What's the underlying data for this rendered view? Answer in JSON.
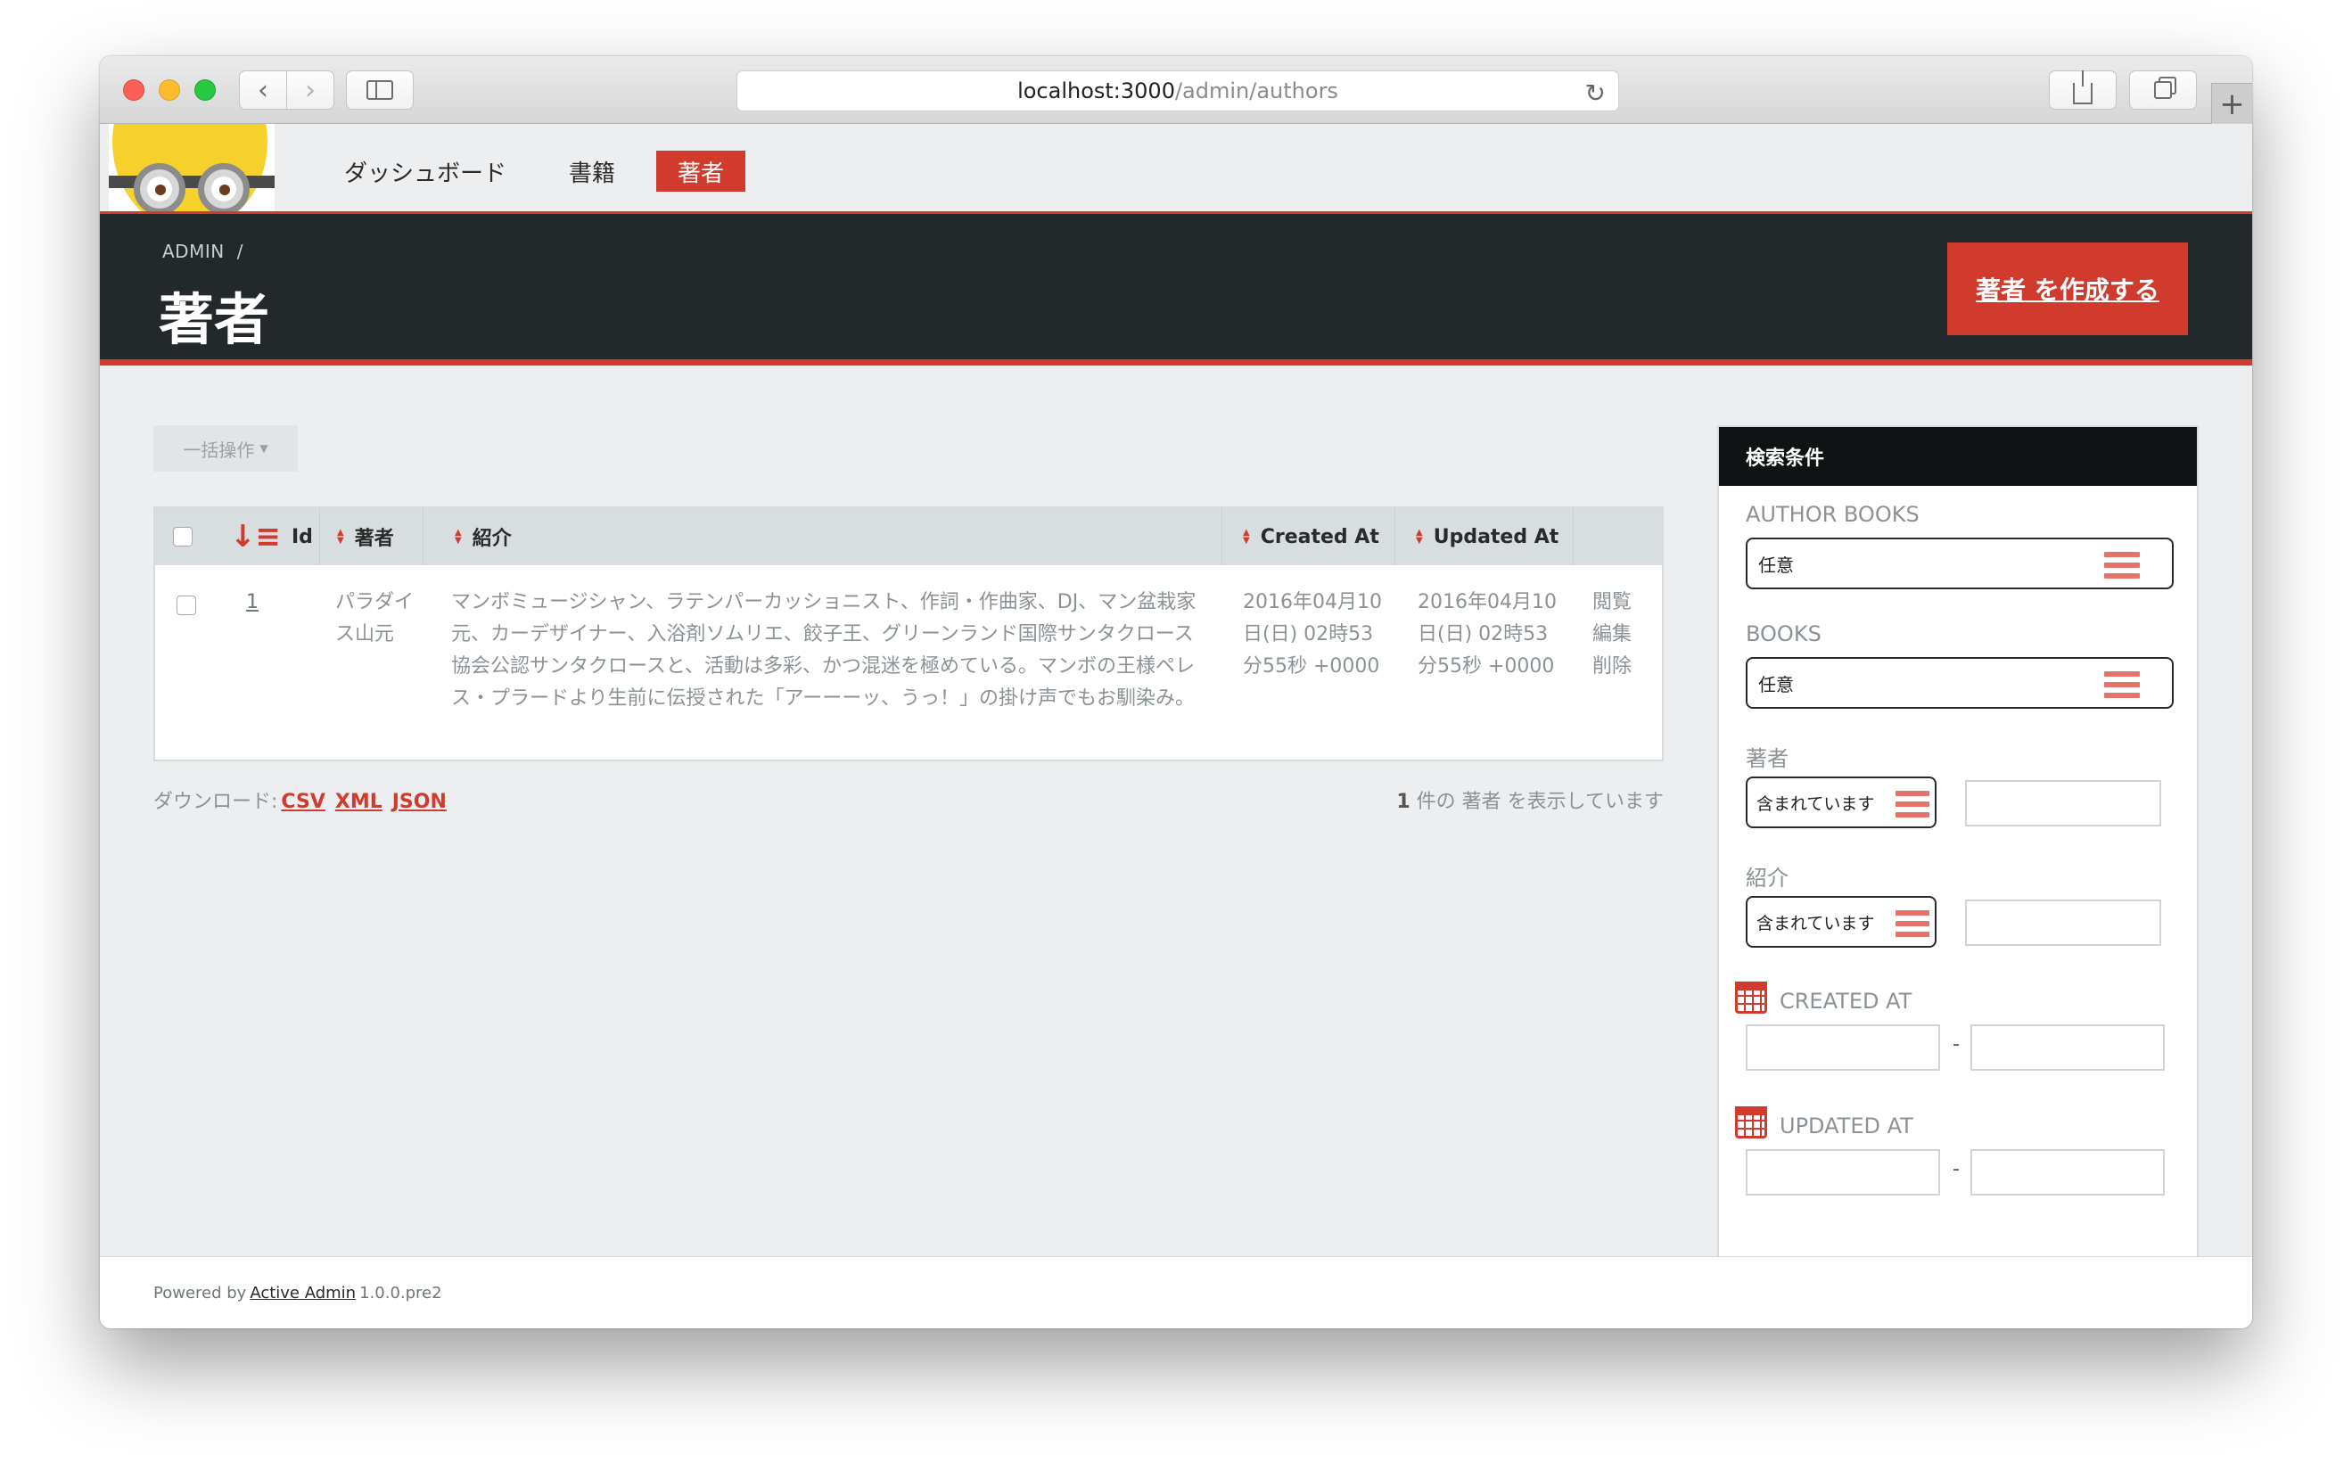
{
  "browser": {
    "url_host": "localhost:3000",
    "url_path": "/admin/authors"
  },
  "nav": {
    "tabs": [
      {
        "label": "ダッシュボード"
      },
      {
        "label": "書籍"
      },
      {
        "label": "著者",
        "current": true
      }
    ]
  },
  "title_bar": {
    "breadcrumb": "ADMIN",
    "breadcrumb_sep": "/",
    "title": "著者",
    "create_button": "著者 を作成する"
  },
  "batch_actions": {
    "label": "一括操作"
  },
  "table": {
    "columns": [
      "Id",
      "著者",
      "紹介",
      "Created At",
      "Updated At"
    ],
    "rows": [
      {
        "id": "1",
        "author": "パラダイス山元",
        "bio": "マンボミュージシャン、ラテンパーカッショニスト、作詞・作曲家、DJ、マン盆栽家元、カーデザイナー、入浴剤ソムリエ、餃子王、グリーンランド国際サンタクロース協会公認サンタクロースと、活動は多彩、かつ混迷を極めている。マンボの王様ペレス・プラードより生前に伝授された「アーーーッ、うっ！」の掛け声でもお馴染み。",
        "created_at": "2016年04月10日(日) 02時53分55秒 +0000",
        "updated_at": "2016年04月10日(日) 02時53分55秒 +0000",
        "actions": [
          "閲覧",
          "編集",
          "削除"
        ]
      }
    ]
  },
  "download": {
    "label": "ダウンロード:",
    "formats": [
      "CSV",
      "XML",
      "JSON"
    ]
  },
  "pagination": {
    "count": "1",
    "text": "件の 著者 を表示しています"
  },
  "filters": {
    "title": "検索条件",
    "author_books": {
      "label": "AUTHOR BOOKS",
      "value": "任意"
    },
    "books": {
      "label": "BOOKS",
      "value": "任意"
    },
    "name": {
      "label": "著者",
      "operator": "含まれています"
    },
    "bio": {
      "label": "紹介",
      "operator": "含まれています"
    },
    "created_at": {
      "label": "CREATED AT",
      "separator": "-"
    },
    "updated_at": {
      "label": "UPDATED AT",
      "separator": "-"
    }
  },
  "footer": {
    "prefix": "Powered by",
    "link": "Active Admin",
    "version": "1.0.0.pre2"
  },
  "colors": {
    "accent": "#d03b2d",
    "header_dark": "#23292a",
    "filter_head": "#101314"
  }
}
